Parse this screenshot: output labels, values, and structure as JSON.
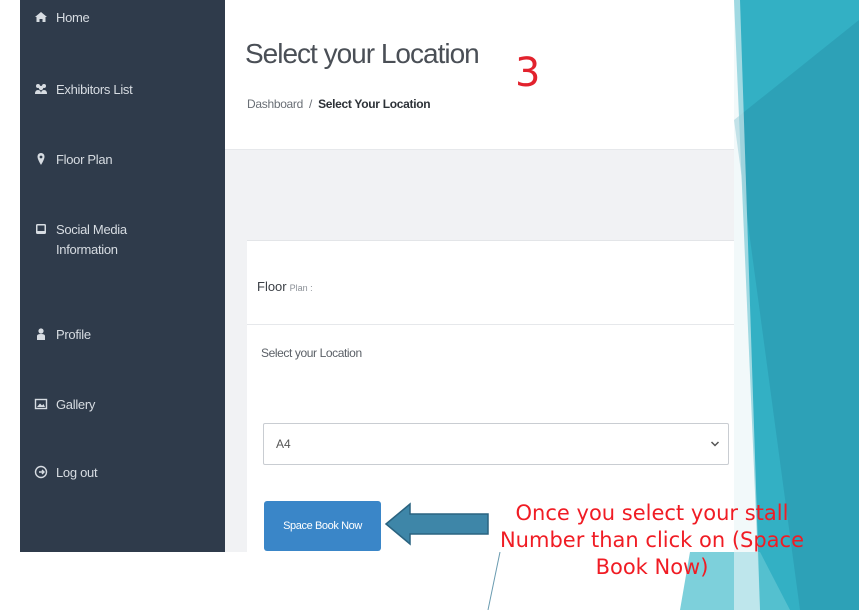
{
  "sidebar": {
    "items": [
      {
        "label": "Home",
        "icon": "home-icon"
      },
      {
        "label": "Exhibitors List",
        "icon": "users-icon"
      },
      {
        "label": "Floor Plan",
        "icon": "map-marker-icon"
      },
      {
        "label": "Social Media\nInformation",
        "icon": "tablet-icon"
      },
      {
        "label": "Profile",
        "icon": "user-icon"
      },
      {
        "label": "Gallery",
        "icon": "picture-icon"
      },
      {
        "label": "Log out",
        "icon": "sign-out-icon"
      }
    ]
  },
  "header": {
    "title": "Select your Location",
    "breadcrumb": {
      "root": "Dashboard",
      "separator": "/",
      "current": "Select Your Location"
    }
  },
  "card": {
    "title": "Floor",
    "title_sub": "Plan :",
    "field_label": "Select your Location",
    "select_value": "A4",
    "button_label": "Space Book Now"
  },
  "annotation": {
    "step": "3",
    "callout": "Once you select your stall Number than click on (Space Book Now)"
  },
  "colors": {
    "sidebar_bg": "#2f3b4b",
    "button_bg": "#3a86c8",
    "annotation_red": "#f01c24",
    "arrow_fill": "#3e86a8",
    "decor_teal": "#3ab3c6"
  }
}
